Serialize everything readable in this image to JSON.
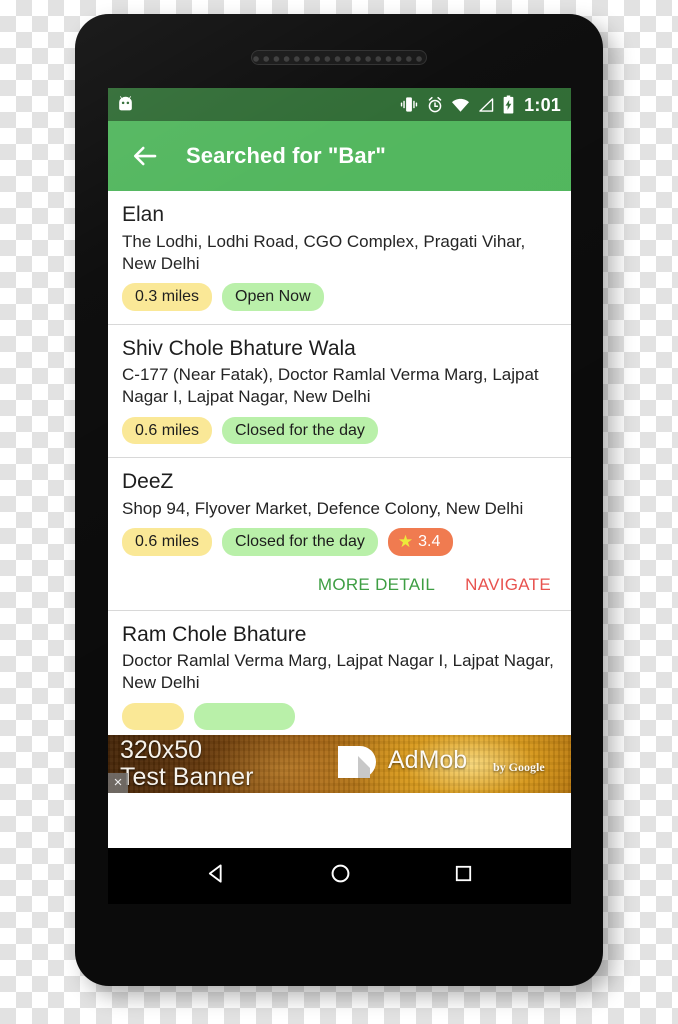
{
  "device": {
    "speaker_name": "earpiece-speaker"
  },
  "statusbar": {
    "app_icon": "android-robot-icon",
    "icons": [
      "vibrate-icon",
      "alarm-icon",
      "wifi-icon",
      "signal-icon",
      "battery-charging-icon"
    ],
    "clock": "1:01",
    "background_color": "#2f6b34"
  },
  "appbar": {
    "back_icon": "back-arrow-icon",
    "title": "Searched for \"Bar\"",
    "background_color": "#51b65d"
  },
  "list": {
    "items": [
      {
        "name": "Elan",
        "address": "The Lodhi, Lodhi Road, CGO Complex, Pragati Vihar, New Delhi",
        "distance": "0.3 miles",
        "status": "Open Now",
        "rating": null,
        "expanded": false
      },
      {
        "name": "Shiv Chole Bhature Wala",
        "address": "C-177 (Near Fatak), Doctor Ramlal Verma Marg, Lajpat Nagar I, Lajpat Nagar, New Delhi",
        "distance": "0.6 miles",
        "status": "Closed for the day",
        "rating": null,
        "expanded": false
      },
      {
        "name": "DeeZ",
        "address": "Shop 94, Flyover Market, Defence Colony, New Delhi",
        "distance": "0.6 miles",
        "status": "Closed for the day",
        "rating": "3.4",
        "expanded": true
      },
      {
        "name": "Ram Chole Bhature",
        "address": "Doctor Ramlal Verma Marg, Lajpat Nagar I, Lajpat Nagar, New Delhi",
        "distance": "",
        "status": "",
        "rating": null,
        "expanded": false
      }
    ],
    "actions": {
      "more_detail": "MORE DETAIL",
      "navigate": "NAVIGATE"
    },
    "colors": {
      "chip_distance": "#fae896",
      "chip_status": "#b9f0a9",
      "chip_rating": "#f07b50",
      "star": "#ecea3a",
      "more_detail": "#3e9e43",
      "navigate": "#e8534f"
    }
  },
  "ad": {
    "size_label": "320x50",
    "banner_label": "Test Banner",
    "brand": "AdMob",
    "byline": "by Google",
    "close_label": "×",
    "logo_icon": "admob-logo-icon"
  },
  "navbar": {
    "back": "nav-back-icon",
    "home": "nav-home-icon",
    "recents": "nav-recents-icon"
  }
}
